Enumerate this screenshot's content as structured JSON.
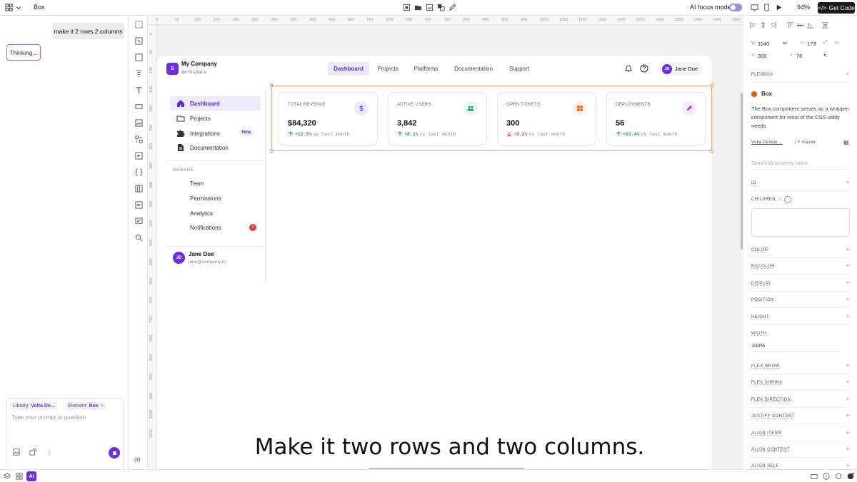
{
  "topbar": {
    "title": "Box",
    "ai_focus_label": "AI focus mode",
    "zoom": "94%",
    "get_code": "Get Code"
  },
  "chat": {
    "user_message": "make it 2 rows 2 columns",
    "status": "Thinking...",
    "chip_library_label": "Library:",
    "chip_library_value": "Volta De...",
    "chip_element_label": "Element:",
    "chip_element_value": "Box",
    "placeholder": "Type your prompt or question"
  },
  "ruler": {
    "h": [
      "0",
      "50",
      "100",
      "150",
      "200",
      "250",
      "300",
      "350",
      "400",
      "450",
      "500",
      "550",
      "600",
      "650",
      "700",
      "750",
      "800",
      "850",
      "900",
      "950",
      "1000",
      "1050",
      "1100",
      "1150",
      "1200",
      "1250",
      "1300",
      "1350",
      "1400",
      "1450",
      "1500"
    ],
    "v": [
      "0",
      "50",
      "100",
      "150",
      "200",
      "250",
      "300",
      "350",
      "400",
      "450",
      "500",
      "550",
      "600",
      "650",
      "700",
      "750",
      "800",
      "850",
      "900",
      "950",
      "1000",
      "1050"
    ]
  },
  "app": {
    "logo_letter": "S",
    "name": "My Company",
    "workspace": "@orkspace",
    "nav": [
      "Dashboard",
      "Projects",
      "Platforms",
      "Documentation",
      "Support"
    ],
    "user": {
      "initials": "JD",
      "name": "Jane Doe"
    }
  },
  "sidebar": {
    "items": [
      {
        "label": "Dashboard",
        "icon": "home-icon"
      },
      {
        "label": "Projects",
        "icon": "folder-icon"
      },
      {
        "label": "Integrations",
        "icon": "puzzle-icon",
        "badge": "New"
      },
      {
        "label": "Documentation",
        "icon": "document-icon"
      }
    ],
    "section": "MANAGE",
    "manage": [
      {
        "label": "Team"
      },
      {
        "label": "Permissions"
      },
      {
        "label": "Analytics"
      },
      {
        "label": "Notifications",
        "count": "3"
      }
    ],
    "user": {
      "initials": "JD",
      "name": "Jane Doe",
      "email": "jane@company.io"
    }
  },
  "cards": [
    {
      "label": "TOTAL REVENUE",
      "value": "$84,320",
      "delta": "+12.5%",
      "suffix": "vs last month",
      "trend": "up",
      "icon": "dollar-icon",
      "color": "#6b2fe0",
      "bg": "#efeafb"
    },
    {
      "label": "ACTIVE USERS",
      "value": "3,842",
      "delta": "+8.1%",
      "suffix": "vs last month",
      "trend": "up",
      "icon": "users-icon",
      "color": "#16a34a",
      "bg": "#e8f7ee"
    },
    {
      "label": "OPEN TICKETS",
      "value": "300",
      "delta": "-3.2%",
      "suffix": "vs last month",
      "trend": "down",
      "icon": "ticket-icon",
      "color": "#ea580c",
      "bg": "#fdefe3"
    },
    {
      "label": "DEPLOYMENTS",
      "value": "56",
      "delta": "+22.4%",
      "suffix": "vs last month",
      "trend": "up",
      "icon": "rocket-icon",
      "color": "#9333ea",
      "bg": "#f5ebfd"
    }
  ],
  "caption": "Make it two rows and two columns.",
  "panel": {
    "w_label": "W",
    "w": "1140",
    "h_label": "H",
    "h": "173",
    "x_label": "X",
    "x": "300",
    "y_label": "Y",
    "y": "76",
    "flexbox": "FLEXBOX",
    "component": "Box",
    "description": "The Box component serves as a wrapper component for most of the CSS utility needs.",
    "library": "Volta Design ...",
    "branch": "master",
    "search_placeholder": "Search by property name",
    "id_label": "ID",
    "children_label": "CHILDREN",
    "props": [
      "COLOR",
      "BGCOLOR",
      "DISPLAY",
      "POSITION",
      "HEIGHT"
    ],
    "width_label": "WIDTH",
    "width_value": "100%",
    "props2": [
      "FLEX GROW",
      "FLEX SHRINK",
      "FLEX DIRECTION",
      "JUSTIFY CONTENT",
      "ALIGN ITEMS",
      "ALIGN CONTENT",
      "ALIGN SELF"
    ]
  },
  "bottom": {
    "ai": "AI",
    "vars": "{$}"
  },
  "colors": {
    "accent": "#6b2fe0",
    "selection": "#f2a477",
    "success": "#16a34a",
    "danger": "#e53935"
  }
}
